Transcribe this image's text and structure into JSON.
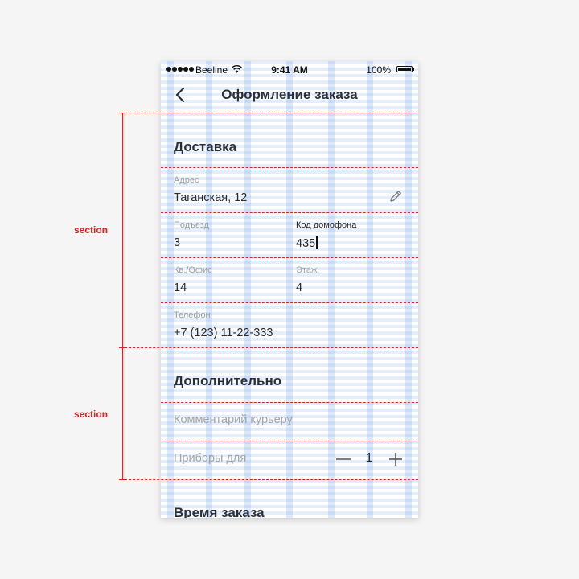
{
  "status_bar": {
    "carrier": "Beeline",
    "time": "9:41 AM",
    "battery": "100%"
  },
  "nav": {
    "title": "Оформление заказа"
  },
  "delivery": {
    "heading": "Доставка",
    "address": {
      "label": "Адрес",
      "value": "Таганская, 12"
    },
    "entrance": {
      "label": "Подъезд",
      "value": "3"
    },
    "intercom": {
      "label": "Код домофона",
      "value": "435"
    },
    "apartment": {
      "label": "Кв./Офис",
      "value": "14"
    },
    "floor": {
      "label": "Этаж",
      "value": "4"
    },
    "phone": {
      "label": "Телефон",
      "value": "+7 (123) 11-22-333"
    }
  },
  "additional": {
    "heading": "Дополнительно",
    "comment_placeholder": "Комментарий курьеру",
    "cutlery_label": "Приборы для",
    "cutlery_count": "1"
  },
  "order_time": {
    "heading": "Время заказа"
  },
  "annotations": {
    "section_label_1": "section",
    "section_label_2": "section"
  },
  "colors": {
    "annotation": "#e22222",
    "grid": "#82aff0",
    "text": "#2a2f3a",
    "muted": "#9a9ea6"
  }
}
